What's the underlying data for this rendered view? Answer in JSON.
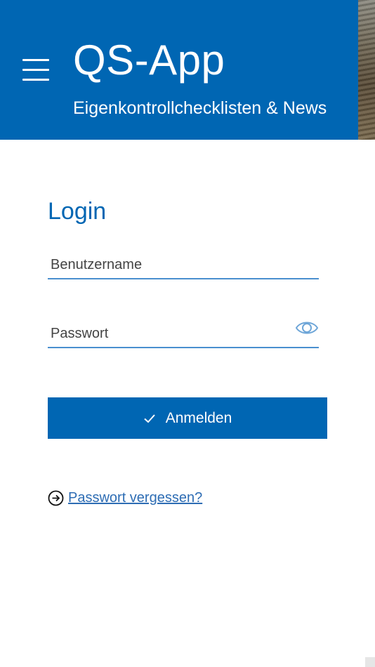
{
  "header": {
    "title": "QS-App",
    "subtitle": "Eigenkontrollchecklisten & News",
    "menu_icon": "hamburger-menu-icon",
    "background_color": "#0066b3"
  },
  "login": {
    "heading": "Login",
    "username": {
      "placeholder": "Benutzername",
      "value": ""
    },
    "password": {
      "placeholder": "Passwort",
      "value": "",
      "toggle_icon": "eye-icon"
    },
    "submit": {
      "label": "Anmelden",
      "icon": "check-icon"
    },
    "forgot": {
      "label": "Passwort vergessen?",
      "icon": "arrow-right-circle-icon"
    }
  },
  "colors": {
    "primary": "#0066b3",
    "link": "#2e6db4",
    "underline": "#4a8fcf"
  }
}
